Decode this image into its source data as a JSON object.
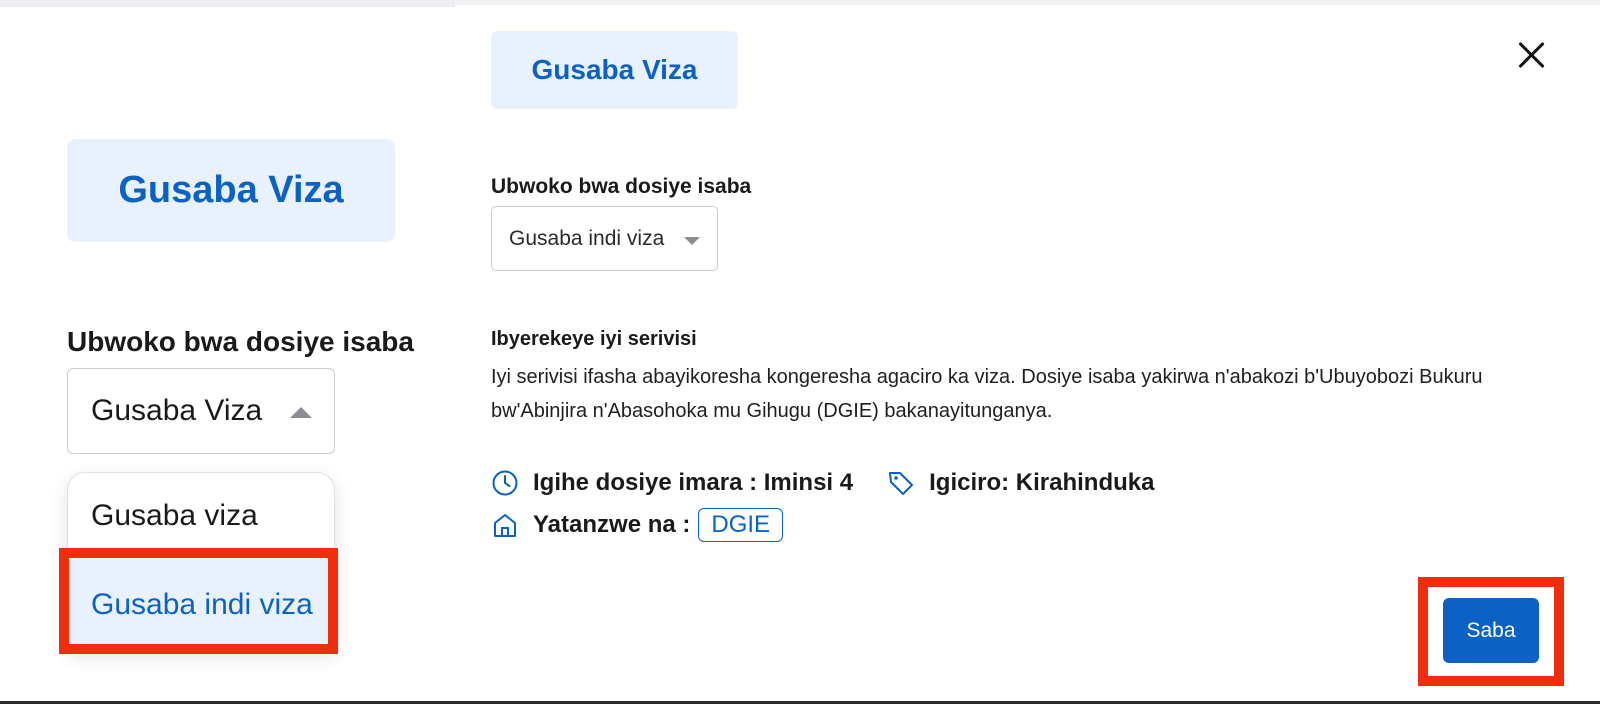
{
  "zoom_panel": {
    "badge": "Gusaba Viza",
    "label": "Ubwoko bwa dosiye isaba",
    "selected_value": "Gusaba Viza",
    "options": [
      "Gusaba viza",
      "Gusaba indi viza"
    ],
    "highlighted_option": "Gusaba indi viza"
  },
  "modal": {
    "tag": "Gusaba Viza",
    "field_label": "Ubwoko bwa dosiye isaba",
    "select_value": "Gusaba indi viza",
    "about_title": "Ibyerekeye iyi serivisi",
    "about_text": "Iyi serivisi ifasha abayikoresha kongeresha agaciro ka viza. Dosiye isaba yakirwa n'abakozi b'Ubuyobozi Bukuru bw'Abinjira n'Abasohoka mu Gihugu (DGIE) bakanayitunganya.",
    "processing_time": "Igihe dosiye imara : Iminsi 4",
    "price": "Igiciro: Kirahinduka",
    "provided_by_label": "Yatanzwe na :",
    "provider": "DGIE",
    "submit_label": "Saba"
  },
  "icons": {
    "close": "close-icon",
    "clock": "clock-icon",
    "tag": "price-tag-icon",
    "building": "building-icon"
  },
  "colors": {
    "accent": "#0b62c4",
    "badge_bg": "#e8f1fc",
    "highlight": "#f02d0c"
  }
}
